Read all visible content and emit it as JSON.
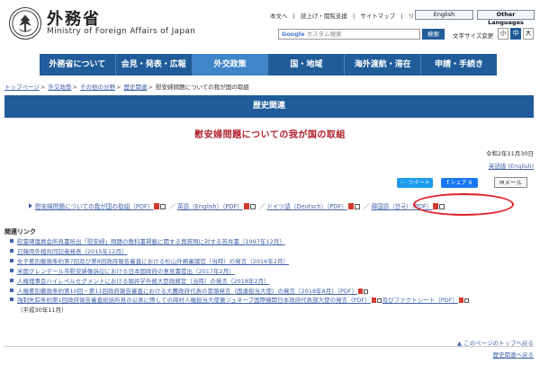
{
  "header": {
    "site_name_ja": "外務省",
    "site_name_en": "Ministry of Foreign Affairs of Japan",
    "top_links": [
      "本文へ",
      "|",
      "読上げ・閲覧支援",
      "|",
      "サイトマップ",
      "|",
      "リンク集"
    ],
    "lang_english": "English",
    "lang_other": "Other Languages",
    "search_brand": "Google",
    "search_placeholder": "カスタム検索",
    "search_button": "検索",
    "font_size_label": "文字サイズ変更",
    "font_small": "小",
    "font_mid": "中",
    "font_large": "大"
  },
  "nav": {
    "items": [
      "外務省について",
      "会見・発表・広報",
      "外交政策",
      "国・地域",
      "海外渡航・滞在",
      "申請・手続き"
    ],
    "active_index": 2
  },
  "breadcrumb": {
    "items": [
      "トップページ",
      "外交政策",
      "その他の分野",
      "歴史関連"
    ],
    "current": "慰安婦問題についての我が国の取組",
    "separator": ">"
  },
  "section_title": "歴史関連",
  "page_title": "慰安婦問題についての我が国の取組",
  "date": "令和2年11月30日",
  "english_link": "英語版 (English)",
  "share": {
    "tweet": "ツイート",
    "share": "シェア 6",
    "mail": "メール"
  },
  "documents": {
    "ja": "慰安婦問題についての我が国の取組（PDF）",
    "en": "英語（English）（PDF）",
    "de": "ドイツ語（Deutsch）（PDF）",
    "ko": "韓国語（한국）（PDF）",
    "sep": "／"
  },
  "related": {
    "title": "関連リンク",
    "items": [
      {
        "text": "慰霊碑議員会所見書所出「慰安婦」問題の教科書掲載に関する再質問に対する答弁書（1997年12月）",
        "pdf": false
      },
      {
        "text": "日韓両外相共同記者発表（2015年12月）",
        "pdf": false
      },
      {
        "text": "女子差別撤廃条約第7回及び第8回政府報告審査における杉山外務審議官（当時）の発言（2016年2月）",
        "pdf": false
      },
      {
        "text": "米国グレンデール市慰安婦像訴訟における日本国政府の意見書提出（2017年2月）",
        "pdf": false
      },
      {
        "text": "人権理事会ハイレベルセグメントにおける堀井学外務大臣政務官（当時）の発言（2018年2月）",
        "pdf": false
      },
      {
        "text": "人権差別撤廃条約第10回・第11回政府報告審査における大鷹政府代表の冒頭発言（国連担当大使）の発言（2018年8月）（PDF）",
        "pdf": true,
        "extra": ""
      },
      {
        "text": "強制失踪条約第1回政府報告審査総括所見の公表に際しての岡村人権担当大使兼ジュネーブ国際機関日本政府代表部大使の発言（PDF）",
        "pdf": true,
        "extra": "及びファクトシート（PDF）"
      }
    ],
    "tail": "（平成30年11月）"
  },
  "footer": {
    "to_top": "このページのトップへ戻る",
    "back": "歴史関連へ戻る"
  }
}
